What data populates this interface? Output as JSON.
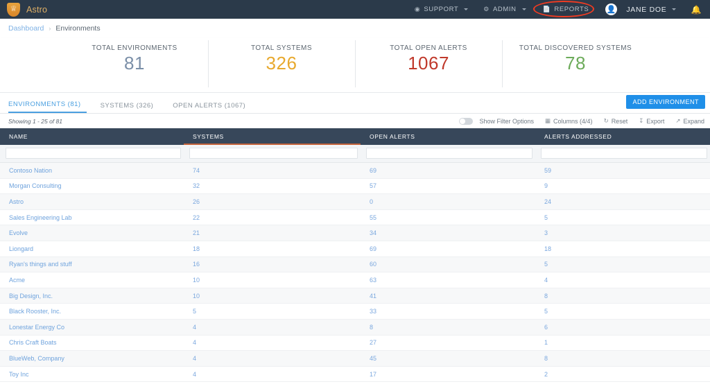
{
  "topnav": {
    "brand": "Astro",
    "logo_icon": "lion-shield-icon",
    "items": [
      {
        "label": "SUPPORT",
        "icon": "help-circle-icon",
        "caret": true
      },
      {
        "label": "ADMIN",
        "icon": "gear-icon",
        "caret": true
      },
      {
        "label": "REPORTS",
        "icon": "document-icon",
        "caret": false,
        "highlighted": true
      }
    ],
    "user": "JANE DOE",
    "user_icon": "avatar-icon",
    "bell_icon": "bell-icon",
    "highlight_color": "#ef3b22"
  },
  "breadcrumb": {
    "root": "Dashboard",
    "separator": "›",
    "current": "Environments"
  },
  "stats": [
    {
      "label": "TOTAL ENVIRONMENTS",
      "value": "81",
      "color": "#7b8fa8"
    },
    {
      "label": "TOTAL SYSTEMS",
      "value": "326",
      "color": "#e8a92e"
    },
    {
      "label": "TOTAL OPEN ALERTS",
      "value": "1067",
      "color": "#c0392b"
    },
    {
      "label": "TOTAL DISCOVERED SYSTEMS",
      "value": "78",
      "color": "#6cab5a"
    }
  ],
  "tabs": [
    {
      "label": "ENVIRONMENTS (81)",
      "active": true
    },
    {
      "label": "SYSTEMS (326)",
      "active": false
    },
    {
      "label": "OPEN ALERTS (1067)",
      "active": false
    }
  ],
  "add_button": {
    "label": "ADD ENVIRONMENT",
    "color": "#1f8fe8"
  },
  "toolbar": {
    "showing": "Showing 1 - 25 of 81",
    "filter_toggle_label": "Show Filter Options",
    "filter_toggle_on": false,
    "columns_label": "Columns (4/4)",
    "columns_icon": "grid-icon",
    "reset_label": "Reset",
    "reset_icon": "refresh-icon",
    "export_label": "Export",
    "export_icon": "download-icon",
    "expand_label": "Expand",
    "expand_icon": "expand-icon"
  },
  "table": {
    "columns": [
      {
        "key": "name",
        "label": "NAME",
        "sorted": false
      },
      {
        "key": "systems",
        "label": "SYSTEMS",
        "sorted": true
      },
      {
        "key": "open_alerts",
        "label": "OPEN ALERTS",
        "sorted": false
      },
      {
        "key": "alerts_addressed",
        "label": "ALERTS ADDRESSED",
        "sorted": false
      }
    ],
    "sort_indicator_color": "#c4633a",
    "filter_inputs": [
      "",
      "",
      "",
      ""
    ],
    "rows": [
      {
        "name": "Contoso Nation",
        "systems": "74",
        "open_alerts": "69",
        "alerts_addressed": "59"
      },
      {
        "name": "Morgan Consulting",
        "systems": "32",
        "open_alerts": "57",
        "alerts_addressed": "9"
      },
      {
        "name": "Astro",
        "systems": "26",
        "open_alerts": "0",
        "alerts_addressed": "24"
      },
      {
        "name": "Sales Engineering Lab",
        "systems": "22",
        "open_alerts": "55",
        "alerts_addressed": "5"
      },
      {
        "name": "Evolve",
        "systems": "21",
        "open_alerts": "34",
        "alerts_addressed": "3"
      },
      {
        "name": "Liongard",
        "systems": "18",
        "open_alerts": "69",
        "alerts_addressed": "18"
      },
      {
        "name": "Ryan's things and stuff",
        "systems": "16",
        "open_alerts": "60",
        "alerts_addressed": "5"
      },
      {
        "name": "Acme",
        "systems": "10",
        "open_alerts": "63",
        "alerts_addressed": "4"
      },
      {
        "name": "Big Design, Inc.",
        "systems": "10",
        "open_alerts": "41",
        "alerts_addressed": "8"
      },
      {
        "name": "Black Rooster, Inc.",
        "systems": "5",
        "open_alerts": "33",
        "alerts_addressed": "5"
      },
      {
        "name": "Lonestar Energy Co",
        "systems": "4",
        "open_alerts": "8",
        "alerts_addressed": "6"
      },
      {
        "name": "Chris Craft Boats",
        "systems": "4",
        "open_alerts": "27",
        "alerts_addressed": "1"
      },
      {
        "name": "BlueWeb, Company",
        "systems": "4",
        "open_alerts": "45",
        "alerts_addressed": "8"
      },
      {
        "name": "Toy Inc",
        "systems": "4",
        "open_alerts": "17",
        "alerts_addressed": "2"
      }
    ]
  }
}
